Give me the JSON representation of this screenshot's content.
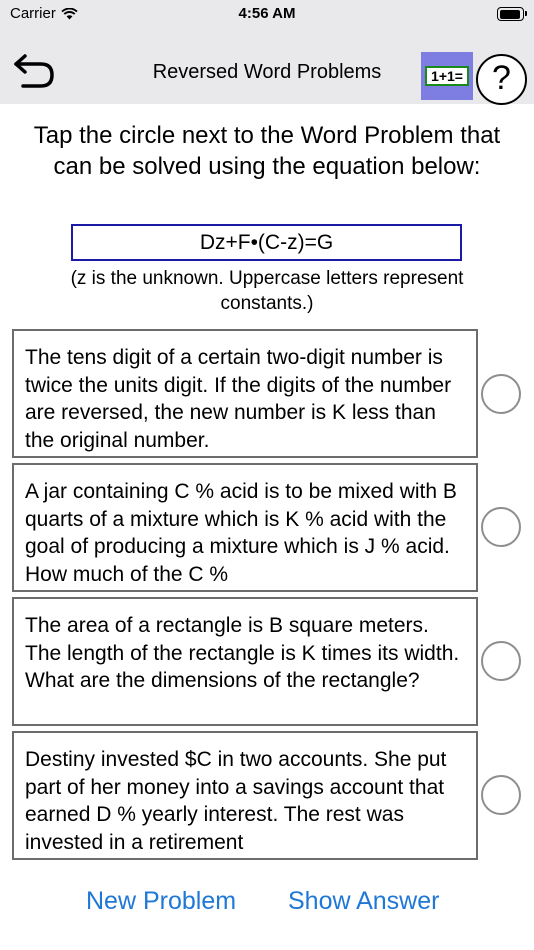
{
  "status_bar": {
    "carrier": "Carrier",
    "time": "4:56 AM",
    "battery_level": 0.95
  },
  "nav": {
    "back_icon": "back-arrow-icon",
    "title": "Reversed Word Problems",
    "calculator_label": "1+1=",
    "help_label": "?"
  },
  "instructions": {
    "prompt": "Tap the circle next to the Word Problem that can be solved using the equation below:",
    "equation": "Dz+F•(C-z)=G",
    "note": "(z is the unknown. Uppercase letters represent constants.)"
  },
  "choices": [
    {
      "text": "The tens digit of a certain two-digit number is twice the units digit. If the digits of the number are reversed, the new number is K less than the original number."
    },
    {
      "text": "A jar containing C % acid is to be mixed with B quarts of a mixture which is K % acid with the goal of producing a mixture which is J % acid.  How much of the C %"
    },
    {
      "text": "The area of a rectangle is B square meters. The length of the rectangle is K times its width.  What are the dimensions of the rectangle?"
    },
    {
      "text": "Destiny invested $C in two accounts.  She put part of her money into a savings account that earned D % yearly interest. The rest was invested in a retirement"
    }
  ],
  "footer": {
    "new_problem_label": "New Problem",
    "show_answer_label": "Show Answer"
  },
  "colors": {
    "bar_background": "#e9e9eb",
    "link_blue": "#1f78d6",
    "equation_border": "#1a1aa6",
    "calculator_purple": "#7e7ee2",
    "calculator_green": "#1a8a1a"
  }
}
